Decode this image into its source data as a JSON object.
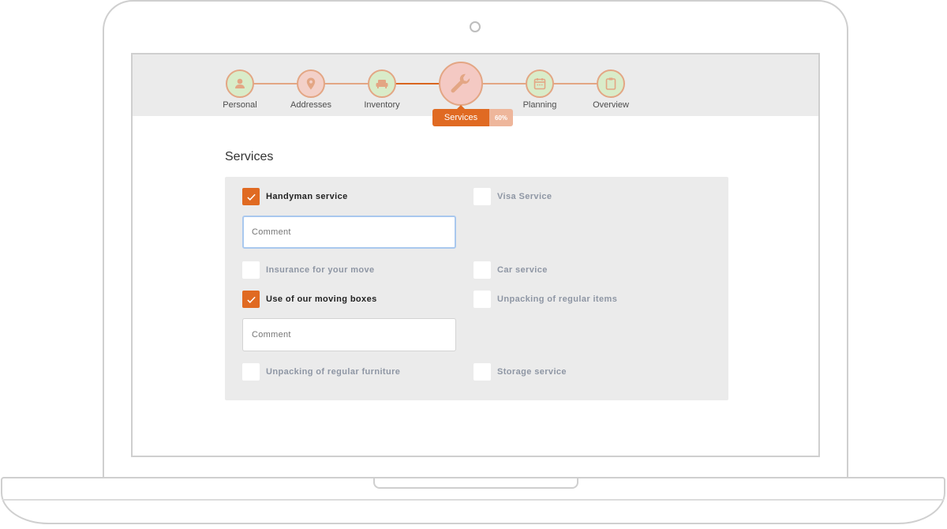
{
  "stepper": {
    "steps": [
      {
        "label": "Personal",
        "icon": "person-icon",
        "state": "done"
      },
      {
        "label": "Addresses",
        "icon": "map-pin-icon",
        "state": "done"
      },
      {
        "label": "Inventory",
        "icon": "sofa-icon",
        "state": "done"
      },
      {
        "label": "Services",
        "icon": "wrench-icon",
        "state": "active"
      },
      {
        "label": "Planning",
        "icon": "calendar-icon",
        "state": "pending"
      },
      {
        "label": "Overview",
        "icon": "clipboard-icon",
        "state": "pending"
      }
    ],
    "active_label": "Services",
    "progress_label": "60%",
    "progress": 0.6
  },
  "section": {
    "title": "Services"
  },
  "options": [
    {
      "label": "Handyman service",
      "checked": true
    },
    {
      "label": "Visa Service",
      "checked": false
    },
    {
      "label": "Insurance for your move",
      "checked": false
    },
    {
      "label": "Car service",
      "checked": false
    },
    {
      "label": "Use of our moving boxes",
      "checked": true
    },
    {
      "label": "Unpacking of regular items",
      "checked": false
    },
    {
      "label": "Unpacking of regular furniture",
      "checked": false
    },
    {
      "label": "Storage service",
      "checked": false
    }
  ],
  "comments": [
    {
      "placeholder": "Comment",
      "value": ""
    },
    {
      "placeholder": "Comment",
      "value": ""
    }
  ],
  "colors": {
    "accent": "#e06a22",
    "accent_light": "#eeb69b",
    "step_done_fill": "#d9ecc9",
    "step_border": "#e3a684",
    "panel_bg": "#ebebeb",
    "label_muted": "#8e96a4"
  }
}
